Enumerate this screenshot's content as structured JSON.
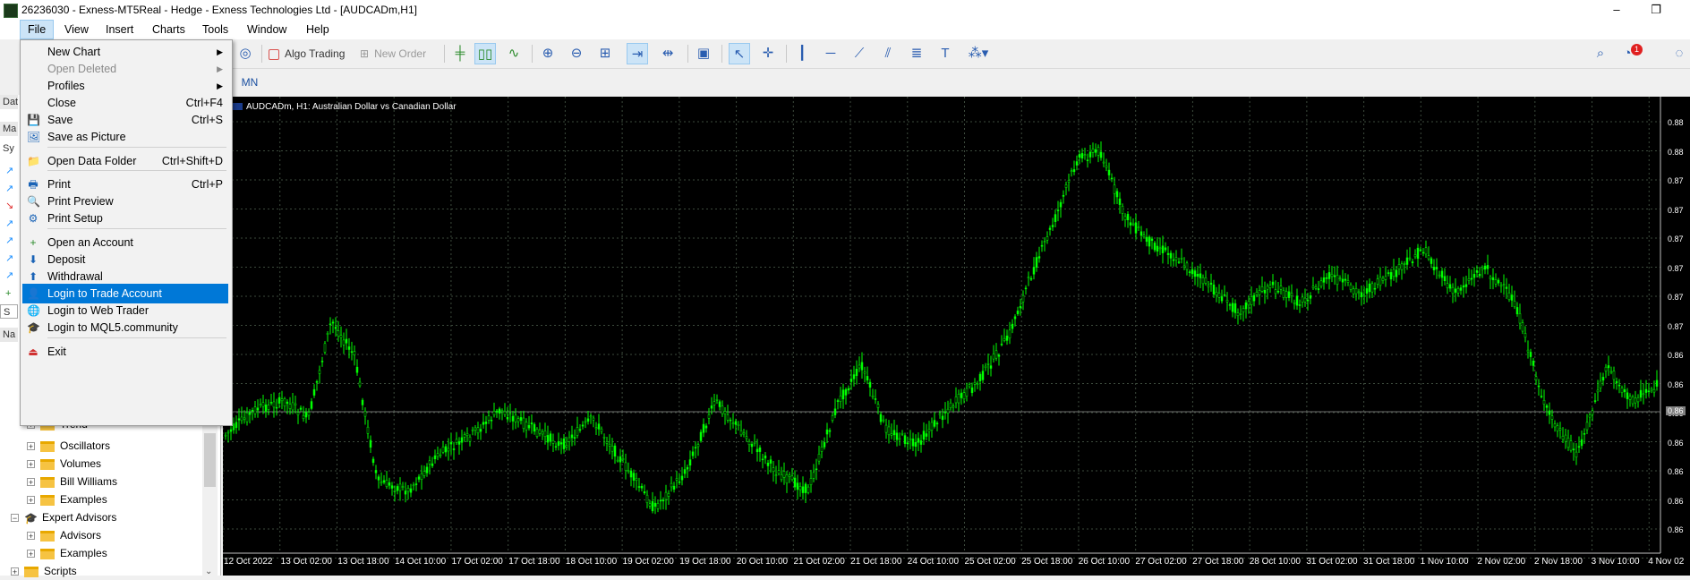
{
  "window": {
    "title": "26236030 - Exness-MT5Real - Hedge - Exness Technologies Ltd - [AUDCADm,H1]",
    "minimize": "–",
    "restore": "❐"
  },
  "menubar": [
    "File",
    "View",
    "Insert",
    "Charts",
    "Tools",
    "Window",
    "Help"
  ],
  "toolbar": {
    "algo_trading": "Algo Trading",
    "new_order": "New Order",
    "notifications_count": "1",
    "timeframe_mn": "MN"
  },
  "file_menu": [
    {
      "label": "New Chart",
      "shortcut": "",
      "submenu": true,
      "disabled": false,
      "icon": ""
    },
    {
      "label": "Open Deleted",
      "shortcut": "",
      "submenu": true,
      "disabled": true,
      "icon": ""
    },
    {
      "label": "Profiles",
      "shortcut": "",
      "submenu": true,
      "disabled": false,
      "icon": ""
    },
    {
      "label": "Close",
      "shortcut": "Ctrl+F4",
      "submenu": false,
      "disabled": false,
      "icon": ""
    },
    {
      "label": "Save",
      "shortcut": "Ctrl+S",
      "submenu": false,
      "disabled": false,
      "icon": "save-icon"
    },
    {
      "label": "Save as Picture",
      "shortcut": "",
      "submenu": false,
      "disabled": false,
      "icon": "picture-icon"
    },
    {
      "label": "Open Data Folder",
      "shortcut": "Ctrl+Shift+D",
      "submenu": false,
      "disabled": false,
      "icon": "folder-icon"
    },
    {
      "label": "Print",
      "shortcut": "Ctrl+P",
      "submenu": false,
      "disabled": false,
      "icon": "printer-icon"
    },
    {
      "label": "Print Preview",
      "shortcut": "",
      "submenu": false,
      "disabled": false,
      "icon": "print-preview-icon"
    },
    {
      "label": "Print Setup",
      "shortcut": "",
      "submenu": false,
      "disabled": false,
      "icon": "print-setup-icon"
    },
    {
      "label": "Open an Account",
      "shortcut": "",
      "submenu": false,
      "disabled": false,
      "icon": "plus-icon"
    },
    {
      "label": "Deposit",
      "shortcut": "",
      "submenu": false,
      "disabled": false,
      "icon": "deposit-icon"
    },
    {
      "label": "Withdrawal",
      "shortcut": "",
      "submenu": false,
      "disabled": false,
      "icon": "withdrawal-icon"
    },
    {
      "label": "Login to Trade Account",
      "shortcut": "",
      "submenu": false,
      "disabled": false,
      "icon": "user-icon",
      "highlighted": true
    },
    {
      "label": "Login to Web Trader",
      "shortcut": "",
      "submenu": false,
      "disabled": false,
      "icon": "globe-icon"
    },
    {
      "label": "Login to MQL5.community",
      "shortcut": "",
      "submenu": false,
      "disabled": false,
      "icon": "mql5-icon"
    },
    {
      "label": "Exit",
      "shortcut": "",
      "submenu": false,
      "disabled": false,
      "icon": "exit-icon"
    }
  ],
  "navigator": {
    "tab_stubs": [
      "Dat",
      "Ma",
      "Sy",
      "S",
      "Na"
    ],
    "items": [
      {
        "label": "Trend",
        "type": "folder",
        "level": 1
      },
      {
        "label": "Oscillators",
        "type": "folder",
        "level": 1
      },
      {
        "label": "Volumes",
        "type": "folder",
        "level": 1
      },
      {
        "label": "Bill Williams",
        "type": "folder",
        "level": 1
      },
      {
        "label": "Examples",
        "type": "folder",
        "level": 1
      },
      {
        "label": "Expert Advisors",
        "type": "ea",
        "level": 0
      },
      {
        "label": "Advisors",
        "type": "folder",
        "level": 1
      },
      {
        "label": "Examples",
        "type": "folder",
        "level": 1
      },
      {
        "label": "Scripts",
        "type": "folder",
        "level": 0
      }
    ]
  },
  "chart": {
    "symbol_label": "AUDCADm, H1:  Australian Dollar vs Canadian Dollar",
    "x_labels": [
      "12 Oct 2022",
      "13 Oct 02:00",
      "13 Oct 18:00",
      "14 Oct 10:00",
      "17 Oct 02:00",
      "17 Oct 18:00",
      "18 Oct 10:00",
      "19 Oct 02:00",
      "19 Oct 18:00",
      "20 Oct 10:00",
      "21 Oct 02:00",
      "21 Oct 18:00",
      "24 Oct 10:00",
      "25 Oct 02:00",
      "25 Oct 18:00",
      "26 Oct 10:00",
      "27 Oct 02:00",
      "27 Oct 18:00",
      "28 Oct 10:00",
      "31 Oct 02:00",
      "31 Oct 18:00",
      "1 Nov 10:00",
      "2 Nov 02:00",
      "2 Nov 18:00",
      "3 Nov 10:00",
      "4 Nov 02"
    ],
    "y_labels": [
      "0.88",
      "0.88",
      "0.87",
      "0.87",
      "0.87",
      "0.87",
      "0.87",
      "0.87",
      "0.86",
      "0.86",
      "0.86",
      "0.86",
      "0.86",
      "0.86",
      "0.86"
    ],
    "current_price_label": "0.86",
    "colors": {
      "background": "#000000",
      "candle": "#00ff00",
      "grid": "#3c4a3c"
    }
  }
}
